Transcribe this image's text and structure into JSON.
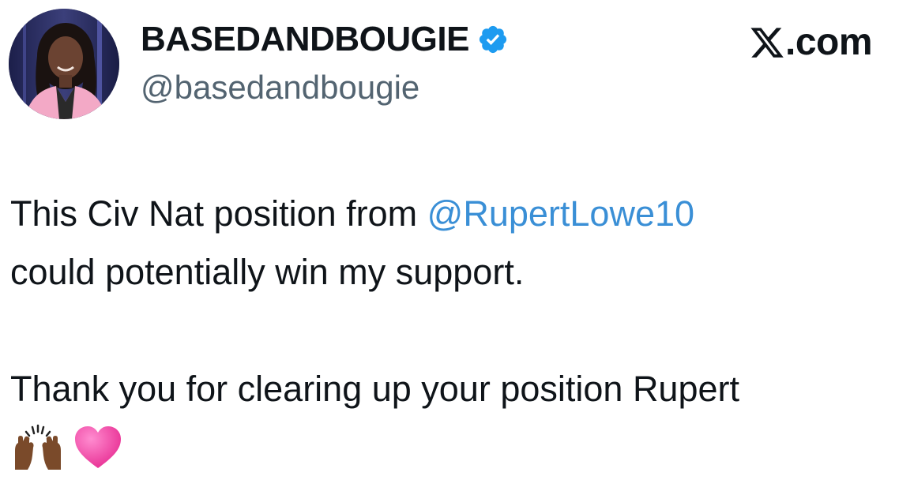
{
  "tweet": {
    "display_name": "BASEDANDBOUGIE",
    "handle": "@basedandbougie",
    "verified_icon": "verified-badge-icon",
    "avatar_icon": "profile-photo",
    "body": {
      "line1_before": "This Civ Nat position from ",
      "mention": "@RupertLowe10",
      "line2": "could potentially win my support.",
      "line3": "Thank you for clearing up your position Rupert",
      "emojis": [
        "raising-hands-dark-skin-emoji",
        "pink-heart-emoji"
      ]
    }
  },
  "brand": {
    "suffix": ".com",
    "icon": "x-logo-icon"
  },
  "colors": {
    "text": "#0f1419",
    "secondary_text": "#536471",
    "mention": "#3a8fd6",
    "verified": "#1d9bf0",
    "background": "#ffffff"
  }
}
